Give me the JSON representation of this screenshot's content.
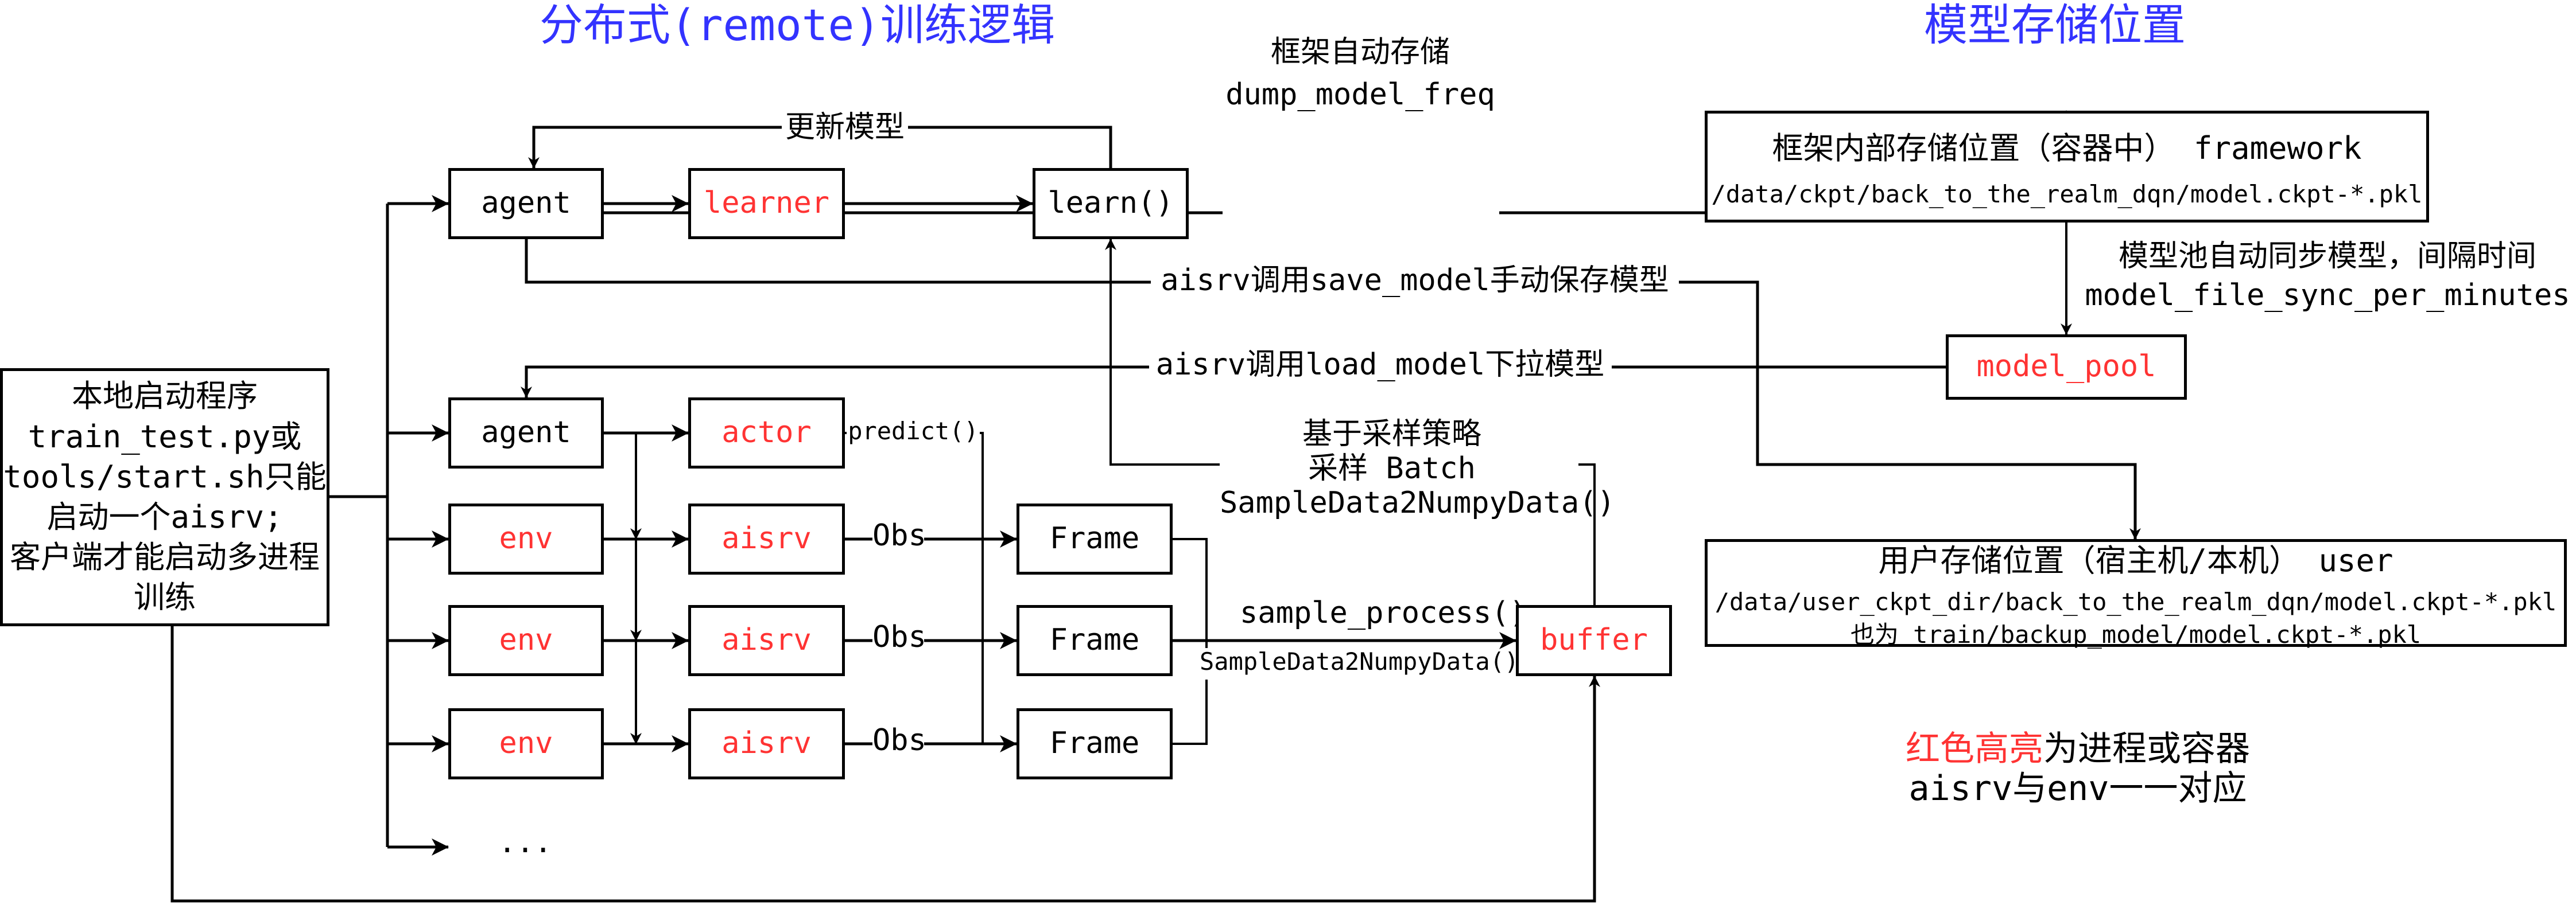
{
  "titles": {
    "training_logic": "分布式(remote)训练逻辑",
    "model_storage": "模型存储位置"
  },
  "launcher": {
    "lines": [
      "本地启动程序",
      "train_test.py或",
      "tools/start.sh只能",
      "启动一个aisrv;",
      "客户端才能启动多进程",
      "训练"
    ]
  },
  "learner_row": {
    "agent": "agent",
    "learner": "learner",
    "learn": "learn()",
    "update_model_label": "更新模型"
  },
  "actor_row": {
    "agent": "agent",
    "actor": "actor",
    "predict_label": "predict()"
  },
  "env_rows": [
    {
      "env": "env",
      "aisrv": "aisrv",
      "obs_label": "Obs",
      "frame": "Frame"
    },
    {
      "env": "env",
      "aisrv": "aisrv",
      "obs_label": "Obs",
      "frame": "Frame"
    },
    {
      "env": "env",
      "aisrv": "aisrv",
      "obs_label": "Obs",
      "frame": "Frame"
    }
  ],
  "ellipsis": "...",
  "buffer": {
    "label": "buffer",
    "sample_process_label": "sample_process()",
    "sample_convert_label": "SampleData2NumpyData()"
  },
  "sampling": {
    "line1": "基于采样策略",
    "line2": "采样 Batch",
    "line3": "SampleData2NumpyData()"
  },
  "framework_autosave": {
    "line1": "框架自动存储",
    "line2": "dump_model_freq"
  },
  "save_model_label": "aisrv调用save_model手动保存模型",
  "load_model_label": "aisrv调用load_model下拉模型",
  "framework_store": {
    "heading": "框架内部存储位置（容器中） framework",
    "path": "/data/ckpt/back_to_the_realm_dqn/model.ckpt-*.pkl"
  },
  "model_pool_sync": {
    "line1": "模型池自动同步模型，间隔时间",
    "line2": "model_file_sync_per_minutes"
  },
  "model_pool": {
    "label": "model_pool"
  },
  "user_store": {
    "heading": "用户存储位置（宿主机/本机） user",
    "path": "/data/user_ckpt_dir/back_to_the_realm_dqn/model.ckpt-*.pkl",
    "alias": "也为 train/backup_model/model.ckpt-*.pkl"
  },
  "legend": {
    "highlight": "红色高亮",
    "highlight_rest": "为进程或容器",
    "mapping": "aisrv与env一一对应"
  },
  "colors": {
    "process_red": "#ff3333",
    "title_blue": "#3333ff",
    "line": "#000000"
  }
}
